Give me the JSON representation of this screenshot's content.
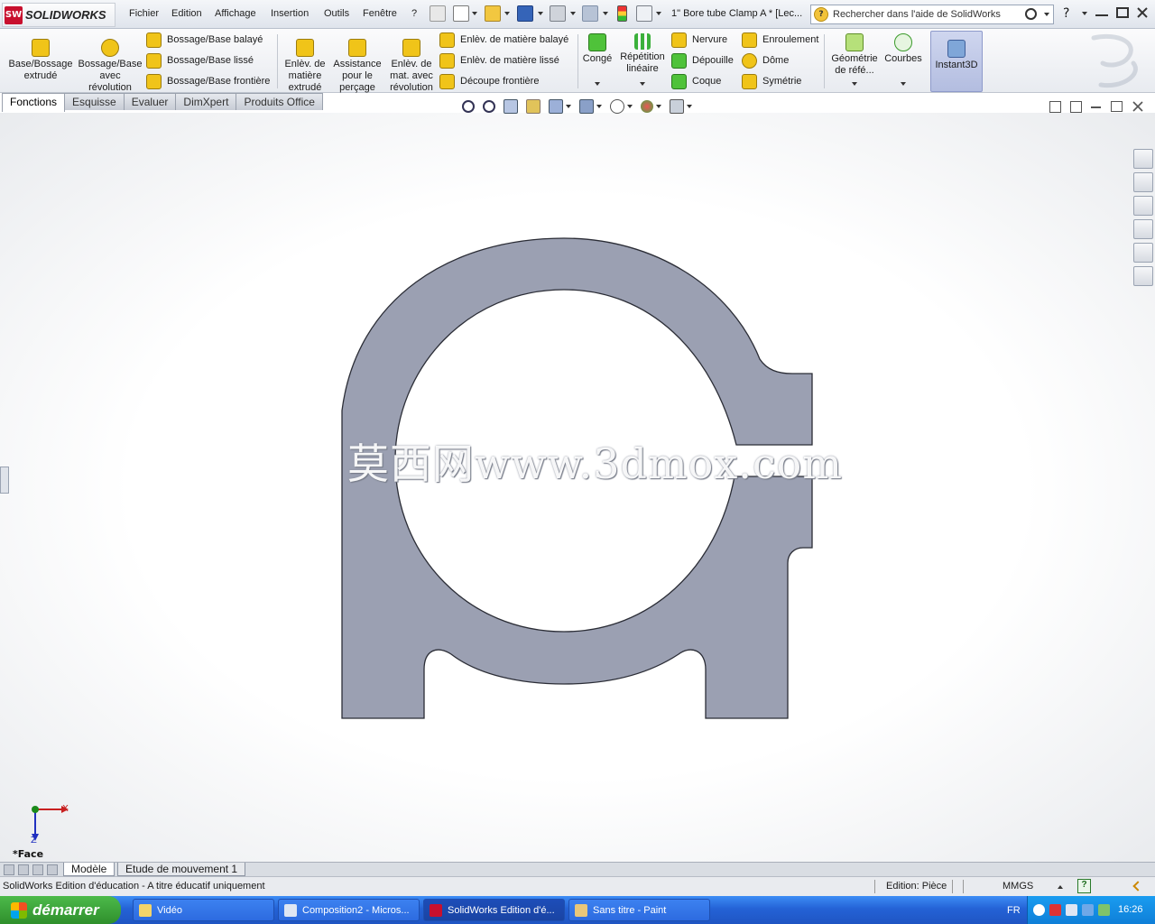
{
  "app": {
    "logo_text": "SOLIDWORKS",
    "logo_badge": "SW",
    "document_title": "1\" Bore tube Clamp A * [Lec...",
    "search_placeholder": "Rechercher dans l'aide de SolidWorks",
    "help_glyph": "?"
  },
  "menu": [
    "Fichier",
    "Edition",
    "Affichage",
    "Insertion",
    "Outils",
    "Fenêtre",
    "?"
  ],
  "command_manager": {
    "big_buttons": [
      {
        "label": "Base/Bossage extrudé",
        "icon": "boss-extrude-icon"
      },
      {
        "label": "Bossage/Base avec révolution",
        "icon": "revolved-boss-icon"
      },
      {
        "label": "Enlèv. de matière extrudé",
        "icon": "extruded-cut-icon"
      },
      {
        "label": "Assistance pour le perçage",
        "icon": "hole-wizard-icon"
      },
      {
        "label": "Enlèv. de mat. avec révolution",
        "icon": "revolved-cut-icon"
      },
      {
        "label": "Congé",
        "icon": "fillet-icon"
      },
      {
        "label": "Répétition linéaire",
        "icon": "linear-pattern-icon"
      },
      {
        "label": "Géométrie de réfé...",
        "icon": "reference-geometry-icon"
      },
      {
        "label": "Courbes",
        "icon": "curves-icon"
      },
      {
        "label": "Instant3D",
        "icon": "instant3d-icon"
      }
    ],
    "small_buttons_col1": [
      {
        "label": "Bossage/Base balayé",
        "icon": "swept-boss-icon"
      },
      {
        "label": "Bossage/Base lissé",
        "icon": "lofted-boss-icon"
      },
      {
        "label": "Bossage/Base frontière",
        "icon": "boundary-boss-icon"
      }
    ],
    "small_buttons_col2": [
      {
        "label": "Enlèv. de matière balayé",
        "icon": "swept-cut-icon"
      },
      {
        "label": "Enlèv. de matière lissé",
        "icon": "lofted-cut-icon"
      },
      {
        "label": "Découpe frontière",
        "icon": "boundary-cut-icon"
      }
    ],
    "small_buttons_col3": [
      {
        "label": "Nervure",
        "icon": "rib-icon"
      },
      {
        "label": "Dépouille",
        "icon": "draft-icon"
      },
      {
        "label": "Coque",
        "icon": "shell-icon"
      }
    ],
    "small_buttons_col4": [
      {
        "label": "Enroulement",
        "icon": "wrap-icon"
      },
      {
        "label": "Dôme",
        "icon": "dome-icon"
      },
      {
        "label": "Symétrie",
        "icon": "mirror-icon"
      }
    ]
  },
  "tabs": [
    "Fonctions",
    "Esquisse",
    "Evaluer",
    "DimXpert",
    "Produits Office"
  ],
  "active_tab": "Fonctions",
  "watermark": "莫西网www.3dmox.com",
  "triad": {
    "x_label": "X",
    "z_label": "Z",
    "view_label": "*Face"
  },
  "bottom_tabs": [
    "Modèle",
    "Etude de mouvement 1"
  ],
  "status": {
    "left": "SolidWorks Edition d'éducation - A titre éducatif uniquement",
    "mode": "Edition: Pièce",
    "units": "MMGS",
    "help_glyph": "?"
  },
  "taskbar": {
    "start_label": "démarrer",
    "tasks": [
      {
        "label": "Vidéo",
        "active": false
      },
      {
        "label": "Composition2 - Micros...",
        "active": false
      },
      {
        "label": "SolidWorks Edition d'é...",
        "active": true
      },
      {
        "label": "Sans titre - Paint",
        "active": false
      }
    ],
    "lang": "FR",
    "clock": "16:26"
  },
  "colors": {
    "part_face": "#9ba0b2",
    "part_edge": "#2b2d36",
    "accent_blue": "#2462d6",
    "sw_red": "#c8102e",
    "start_green": "#3aa537"
  }
}
